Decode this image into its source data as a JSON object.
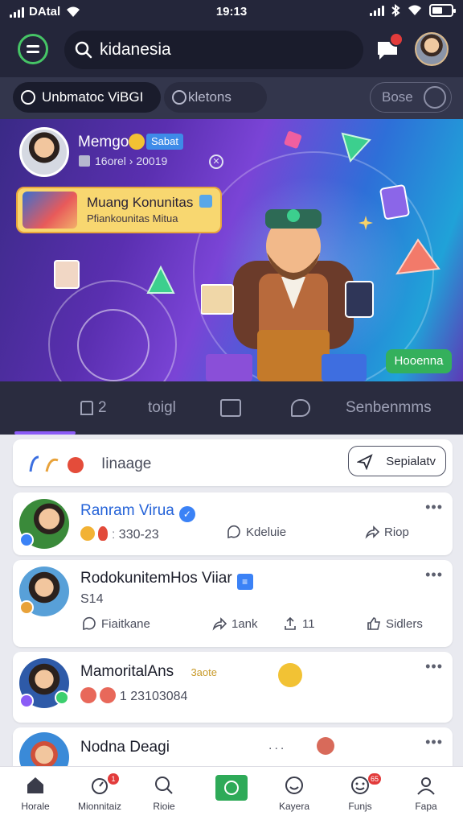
{
  "status_bar": {
    "carrier": "DAtal",
    "time": "19:13"
  },
  "search": {
    "value": "kidanesia"
  },
  "tabs": {
    "active": "Unbmatoc ViBGI",
    "inactive": "kletons",
    "right": "Bose"
  },
  "banner": {
    "host_name": "Memgo",
    "host_badge": "Sabat",
    "host_meta": "16orel › 20019",
    "community_title": "Muang Konunitas",
    "community_sub": "Pfiankounitas Mitua",
    "pill": "Hooenna"
  },
  "section_tabs": [
    "2",
    "toigl",
    "",
    "",
    "Senbenmms"
  ],
  "composer": {
    "text": "Iinaage",
    "button": "Sepialatv"
  },
  "posts": [
    {
      "name": "Ranram Virua",
      "meta": "ː 330-23",
      "actions": [
        "Kdeluie",
        "Riop"
      ]
    },
    {
      "name": "RodokunitemHos Viiar",
      "meta": "S14",
      "actions": [
        "Fiaitkane",
        "1ank",
        "11",
        "Sidlers"
      ]
    },
    {
      "name": "MamoritalAns",
      "tag": "3aote",
      "meta": "1 23103084"
    },
    {
      "name": "Nodna Deagi",
      "meta": "..."
    }
  ],
  "nav": [
    {
      "label": "Horale",
      "icon": "home-icon"
    },
    {
      "label": "Mionnitaiz",
      "icon": "timer-icon",
      "badge": "1"
    },
    {
      "label": "Rioie",
      "icon": "search-icon"
    },
    {
      "label": "",
      "icon": "camera-icon"
    },
    {
      "label": "Kayera",
      "icon": "smile-icon"
    },
    {
      "label": "Funjs",
      "icon": "emoji-icon",
      "badge": "65"
    },
    {
      "label": "Fapa",
      "icon": "profile-icon"
    }
  ],
  "colors": {
    "accent_green": "#46c566",
    "accent_purple": "#8b5cf6",
    "badge_red": "#e23b3b",
    "header_bg": "#24263a"
  }
}
